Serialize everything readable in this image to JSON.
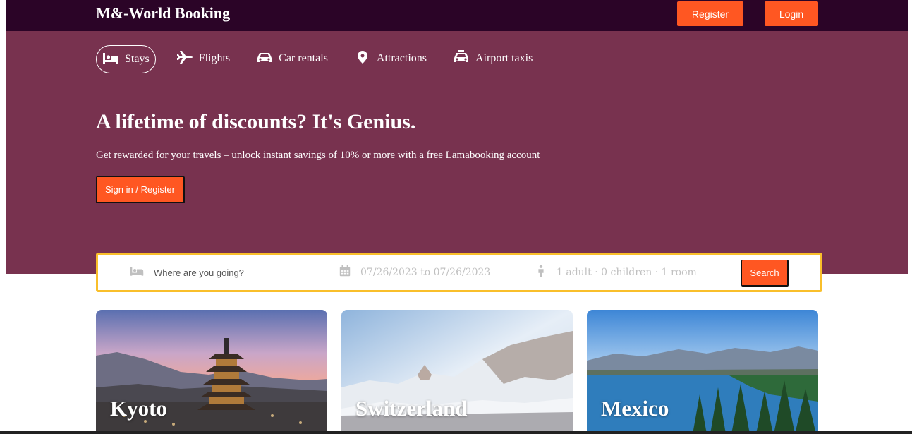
{
  "header": {
    "brand": "M&-World Booking",
    "register_label": "Register",
    "login_label": "Login"
  },
  "nav": {
    "items": [
      {
        "label": "Stays",
        "icon": "bed-icon",
        "active": true
      },
      {
        "label": "Flights",
        "icon": "plane-icon",
        "active": false
      },
      {
        "label": "Car rentals",
        "icon": "car-icon",
        "active": false
      },
      {
        "label": "Attractions",
        "icon": "location-pin-icon",
        "active": false
      },
      {
        "label": "Airport taxis",
        "icon": "taxi-icon",
        "active": false
      }
    ]
  },
  "hero": {
    "title": "A lifetime of discounts? It's Genius.",
    "description": "Get rewarded for your travels – unlock instant savings of 10% or more with a free Lamabooking account",
    "signin_label": "Sign in / Register"
  },
  "search": {
    "destination_placeholder": "Where are you going?",
    "dates": "07/26/2023 to 07/26/2023",
    "guests": "1 adult · 0 children · 1 room",
    "button_label": "Search"
  },
  "featured": [
    {
      "title": "Kyoto"
    },
    {
      "title": "Switzerland"
    },
    {
      "title": "Mexico"
    }
  ],
  "colors": {
    "topbar": "#2b0427",
    "hero": "#78324f",
    "accent": "#ff5722",
    "search_border": "#f9bf2b"
  }
}
